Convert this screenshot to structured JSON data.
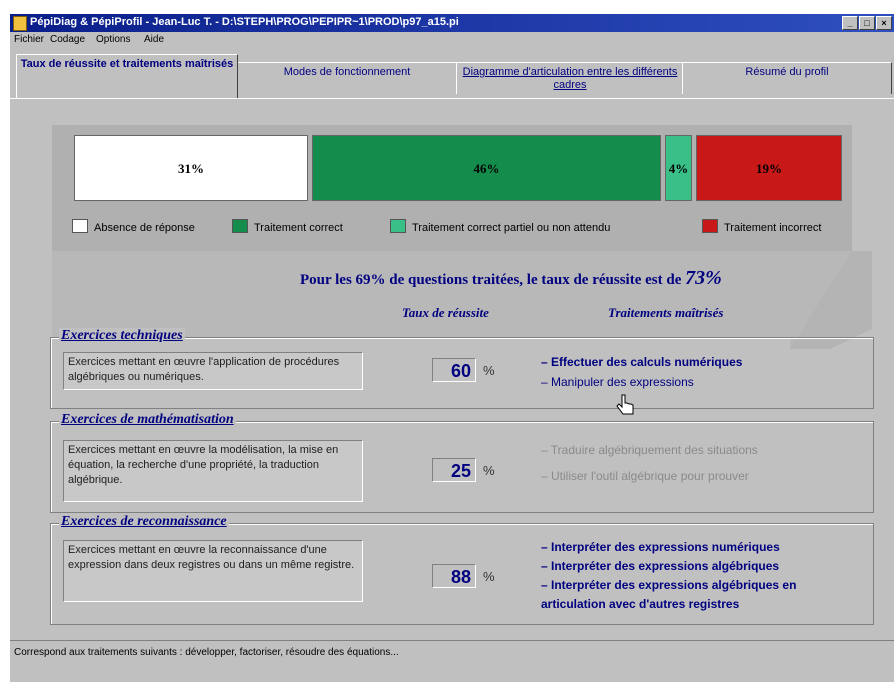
{
  "window": {
    "title": "PépiDiag & PépiProfil - Jean-Luc T. - D:\\STEPH\\PROG\\PEPIPR~1\\PROD\\p97_a15.pi",
    "controls": [
      "_",
      "□",
      "×"
    ]
  },
  "menu": [
    "Fichier",
    "Codage",
    "Options",
    "Aide"
  ],
  "tabs": [
    {
      "label": "Taux de réussite et traitements maîtrisés",
      "active": true
    },
    {
      "label": "Modes de fonctionnement",
      "active": false
    },
    {
      "label": "Diagramme d'articulation entre les différents cadres",
      "active": false
    },
    {
      "label": "Résumé du profil",
      "active": false
    }
  ],
  "chart_data": {
    "type": "bar",
    "orientation": "horizontal-stacked",
    "categories": [
      "Absence de réponse",
      "Traitement correct",
      "Traitement correct partiel ou non attendu",
      "Traitement incorrect"
    ],
    "values": [
      31,
      46,
      4,
      19
    ],
    "labels": [
      "31%",
      "46%",
      "4%",
      "19%"
    ],
    "colors": [
      "#ffffff",
      "#148c4c",
      "#38c088",
      "#c81818"
    ],
    "legend_position": "bottom"
  },
  "summary": {
    "text": "Pour les 69% de questions traitées, le taux de réussite est de ",
    "rate": "73%"
  },
  "columns": {
    "rate_header": "Taux de réussite",
    "skills_header": "Traitements maîtrisés"
  },
  "groups": [
    {
      "title": "Exercices techniques",
      "description": "Exercices mettant en œuvre l'application de procédures algébriques ou numériques.",
      "rate": "60",
      "unit": "%",
      "skills": [
        {
          "label": "– Effectuer des calculs numériques",
          "mastered": true
        },
        {
          "label": "– Manipuler des expressions",
          "mastered": true
        }
      ]
    },
    {
      "title": "Exercices de mathématisation",
      "description": "Exercices mettant en œuvre la modélisation, la mise en équation, la recherche d'une propriété, la traduction algébrique.",
      "rate": "25",
      "unit": "%",
      "skills": [
        {
          "label": "– Traduire algébriquement des situations",
          "mastered": false
        },
        {
          "label": "– Utiliser l'outil algébrique pour prouver",
          "mastered": false
        }
      ]
    },
    {
      "title": "Exercices de reconnaissance",
      "description": "Exercices mettant en œuvre la reconnaissance d'une expression dans deux registres ou dans un même registre.",
      "rate": "88",
      "unit": "%",
      "skills": [
        {
          "label": "– Interpréter des expressions numériques",
          "mastered": true
        },
        {
          "label": "– Interpréter des expressions algébriques",
          "mastered": true
        },
        {
          "label": "– Interpréter des expressions algébriques en articulation avec d'autres registres",
          "mastered": true
        }
      ]
    }
  ],
  "status": "Correspond aux traitements suivants : développer, factoriser, résoudre des équations..."
}
